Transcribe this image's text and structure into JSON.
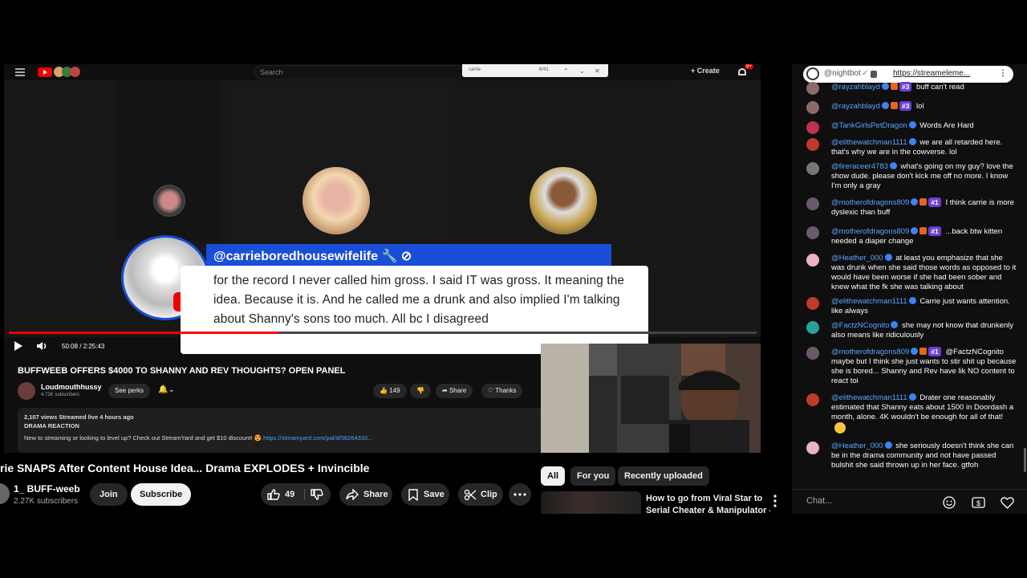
{
  "inner": {
    "search_placeholder": "Search",
    "find_query": "carrie",
    "find_count": "6/41",
    "create_label": "Create",
    "notif_count": "9+",
    "time": "50:08 / 2:25:43",
    "progress_fraction": 0.36,
    "title": "BUFFWEEB OFFERS $4000 TO SHANNY AND REV THOUGHTS? OPEN PANEL",
    "channel_name": "Loudmouthhussy",
    "channel_subs": "4.72K subscribers",
    "perks_label": "See perks",
    "likes": "149",
    "share_label": "Share",
    "thanks_label": "Thanks",
    "desc_meta": "2,107 views  Streamed live 4 hours ago",
    "desc_tag": "DRAMA REACTION",
    "desc_line": "New to streaming or looking to level up? Check out StreamYard and get $10 discount! 😍",
    "desc_link": "https://streamyard.com/pal/d/56264333..."
  },
  "overlay": {
    "handle": "@carrieboredhousewifelife",
    "body": "for the record I never called him gross. I said IT was gross. It meaning the idea. Because it is. And he called me a drunk and also implied I'm talking about Shanny's sons too much. All bc I disagreed"
  },
  "page": {
    "title": "rie SNAPS After Content House Idea... Drama EXPLODES + Invincible",
    "channel_name": "1_ BUFF-weeb",
    "channel_subs": "2.27K subscribers",
    "join_label": "Join",
    "subscribe_label": "Subscribe",
    "likes": "49",
    "share_label": "Share",
    "save_label": "Save",
    "clip_label": "Clip",
    "chips": [
      "All",
      "For you",
      "Recently uploaded"
    ],
    "rec_title_1": "How to go from Viral Star to",
    "rec_title_2": "Serial Cheater & Manipulator - ..."
  },
  "chat": {
    "url_user": "@nightbot",
    "url_text": "https://streameleme...",
    "input_placeholder": "Chat...",
    "messages": [
      {
        "user": "@rayzahblayd",
        "rank": "#3",
        "text": "buff can't read"
      },
      {
        "user": "@rayzahblayd",
        "rank": "#3",
        "text": "lol"
      },
      {
        "user": "@TankGirlsPetDragon",
        "rank": "",
        "text": "Words Are Hard"
      },
      {
        "user": "@elithewatchman1111",
        "rank": "",
        "text": "we are all retarded here. that's why we are in the cowverse. lol"
      },
      {
        "user": "@fireraceer4783",
        "rank": "",
        "text": "what's going on my guy? love the show dude. please don't kick me off no more. I know I'm only a gray"
      },
      {
        "user": "@motherofdragons809",
        "rank": "#1",
        "text": "I think carrie is more dyslexic than buff"
      },
      {
        "user": "@motherofdragons809",
        "rank": "#1",
        "text": "...back btw kitten needed a diaper change"
      },
      {
        "user": "@Heather_000",
        "rank": "",
        "text": "at least you emphasize that she was drunk when she said those words as opposed to it would have been worse if she had been sober and knew what the fk she was talking about"
      },
      {
        "user": "@elithewatchman1111",
        "rank": "",
        "text": "Carrie just wants attention. like always"
      },
      {
        "user": "@FactzNCognito",
        "rank": "",
        "text": "she may not know that drunkenly also means like ridiculously"
      },
      {
        "user": "@motherofdragons809",
        "rank": "#1",
        "text": "@FactzNCognito maybe but I think she just wants to stir shit up because she is bored... Shanny and Rev have lik NO content to react toi"
      },
      {
        "user": "@elithewatchman1111",
        "rank": "",
        "text": "Drater one reasonably estimated that Shanny eats about 1500 in Doordash a month, alone. 4K wouldn't be enough for all of that!"
      },
      {
        "user": "@Heather_000",
        "rank": "",
        "text": "she seriously doesn't think she can be in the drama community and not have passed bulshit she said thrown up in her face. gtfoh"
      }
    ]
  },
  "colors": {
    "accent_blue": "#1a4ed8",
    "yt_red": "#ff0000",
    "rank_purple": "#6b3fd6",
    "link_blue": "#5aa6ff"
  }
}
